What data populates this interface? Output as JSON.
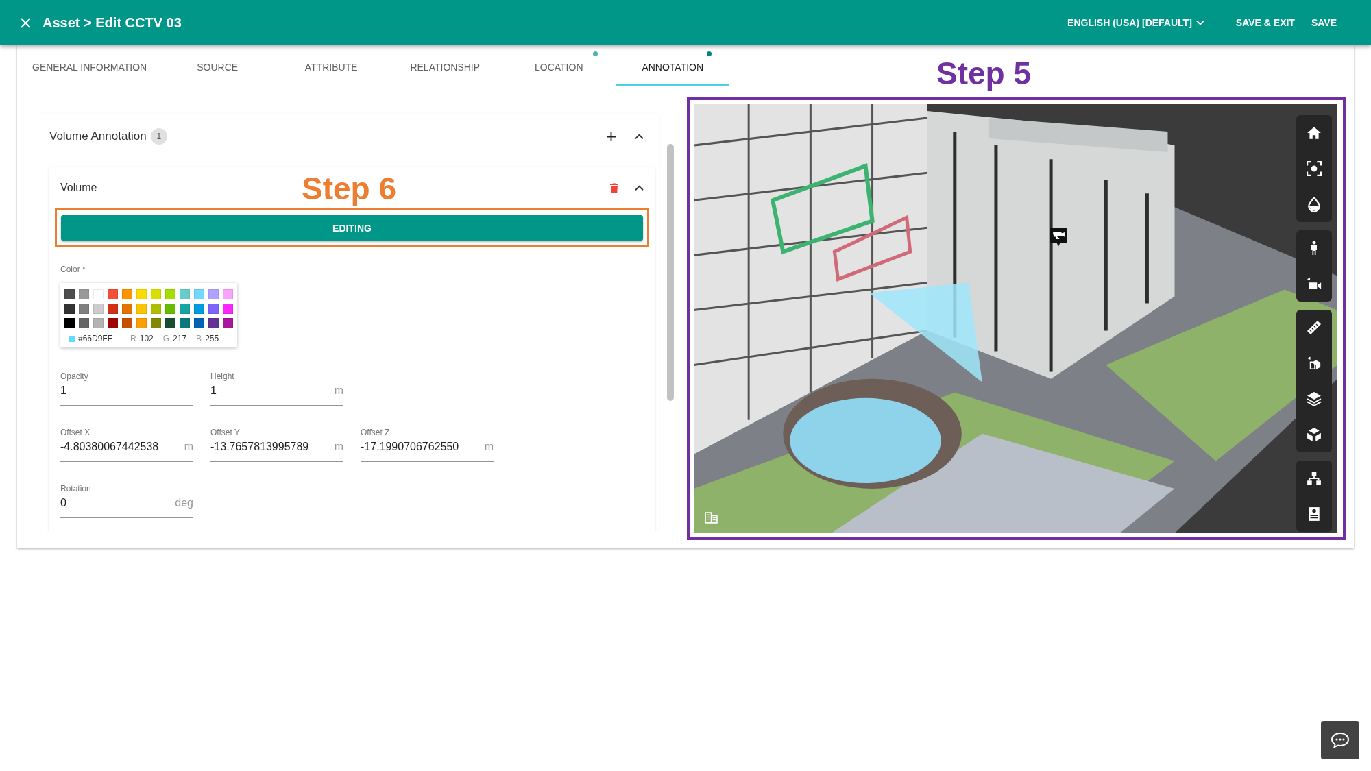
{
  "header": {
    "title": "Asset > Edit CCTV 03",
    "language": "ENGLISH (USA) [DEFAULT]",
    "actions": [
      "SAVE & EXIT",
      "SAVE"
    ]
  },
  "tabs": [
    {
      "label": "GENERAL INFORMATION",
      "selected": false
    },
    {
      "label": "SOURCE",
      "selected": false
    },
    {
      "label": "ATTRIBUTE",
      "selected": false
    },
    {
      "label": "RELATIONSHIP",
      "selected": false
    },
    {
      "label": "LOCATION",
      "selected": false,
      "color": "#4db6ac"
    },
    {
      "label": "ANNOTATION",
      "selected": true,
      "color": "#00897b"
    }
  ],
  "section": {
    "title": "Volume Annotation",
    "count": "1",
    "expanded": true,
    "item": {
      "title": "Volume",
      "callout": "Step 6",
      "expanded": true,
      "button": "EDITING",
      "color_label": "Color *",
      "palette": [
        {
          "color": "#4d4d4d"
        },
        {
          "color": "#999999"
        },
        {
          "color": "#ffffff"
        },
        {
          "color": "#f44e3b"
        },
        {
          "color": "#fe9200"
        },
        {
          "color": "#fcdc00"
        },
        {
          "color": "#dbdf00"
        },
        {
          "color": "#a4dd00"
        },
        {
          "color": "#68ccca"
        },
        {
          "color": "#73d8ff"
        },
        {
          "color": "#aea1ff"
        },
        {
          "color": "#fda1ff"
        },
        {
          "color": "#333333"
        },
        {
          "color": "#808080"
        },
        {
          "color": "#cccccc"
        },
        {
          "color": "#d33115"
        },
        {
          "color": "#e27300"
        },
        {
          "color": "#fcc400"
        },
        {
          "color": "#b0bc00"
        },
        {
          "color": "#68bc00"
        },
        {
          "color": "#16a5a5"
        },
        {
          "color": "#009ce0"
        },
        {
          "color": "#7b64ff"
        },
        {
          "color": "#fa28ff"
        },
        {
          "color": "#000000"
        },
        {
          "color": "#666666"
        },
        {
          "color": "#b3b3b3"
        },
        {
          "color": "#9f0500"
        },
        {
          "color": "#c45100"
        },
        {
          "color": "#fb9e00"
        },
        {
          "color": "#808900"
        },
        {
          "color": "#194d33"
        },
        {
          "color": "#0c797d"
        },
        {
          "color": "#0062b1"
        },
        {
          "color": "#653294"
        },
        {
          "color": "#ab149e"
        }
      ],
      "picked": {
        "color": "#66d9ff",
        "hex": "#66D9FF",
        "channels": [
          {
            "label": "R",
            "value": "102"
          },
          {
            "label": "G",
            "value": "217"
          },
          {
            "label": "B",
            "value": "255"
          }
        ]
      },
      "field_rows": [
        [
          {
            "label": "Opacity",
            "value": "1"
          },
          {
            "label": "Height",
            "value": "1",
            "unit": "m"
          }
        ],
        [
          {
            "label": "Offset X",
            "value": "-4.80380067442538",
            "unit": "m"
          },
          {
            "label": "Offset Y",
            "value": "-13.7657813995789",
            "unit": "m"
          },
          {
            "label": "Offset Z",
            "value": "-17.1990706762550",
            "unit": "m"
          }
        ],
        [
          {
            "label": "Rotation",
            "value": "0",
            "unit": "deg"
          }
        ]
      ]
    }
  },
  "viewer": {
    "callout": "Step 5"
  }
}
